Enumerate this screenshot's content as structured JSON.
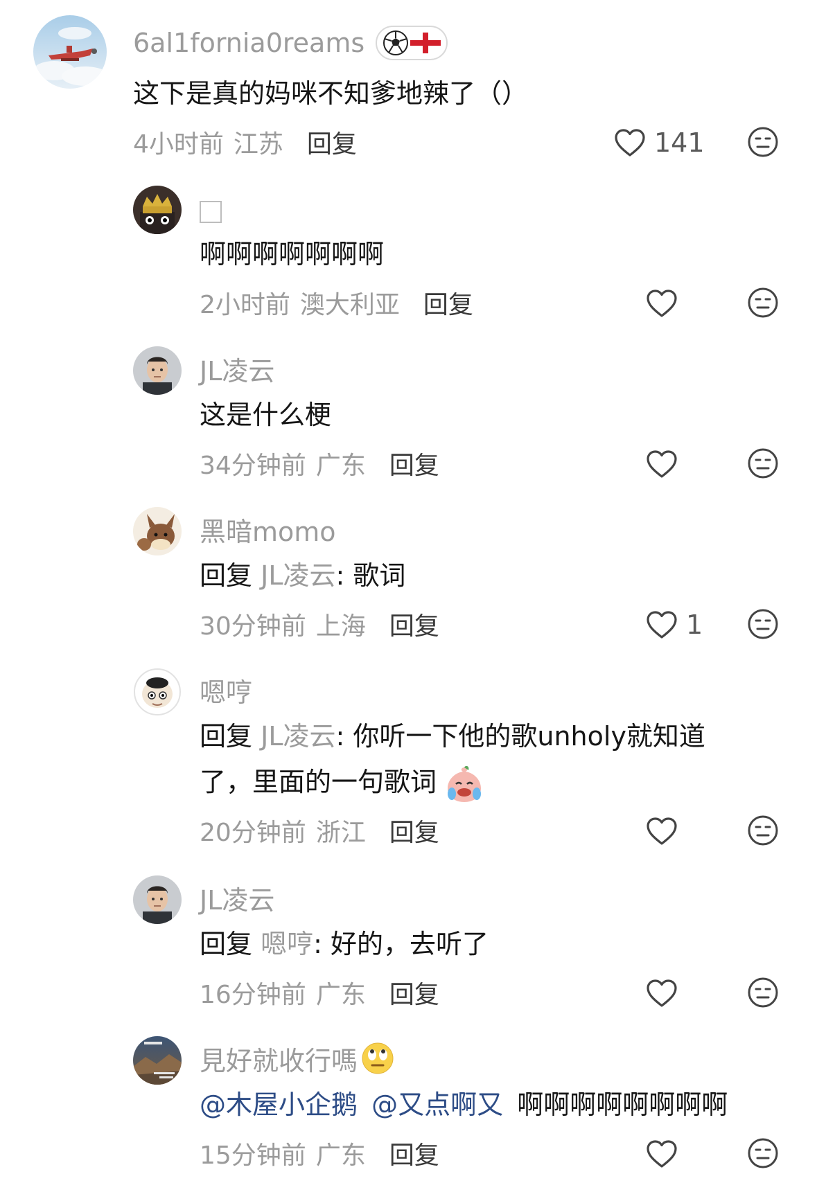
{
  "comments": [
    {
      "username": "6al1fornia0reams",
      "badges": [
        "soccer-ball",
        "england-flag"
      ],
      "text": "这下是真的妈咪不知爹地辣了（）",
      "time": "4小时前",
      "location": "江苏",
      "reply_label": "回复",
      "likes": "141"
    },
    {
      "username": "",
      "text": "啊啊啊啊啊啊啊",
      "time": "2小时前",
      "location": "澳大利亚",
      "reply_label": "回复",
      "likes": ""
    },
    {
      "username": "JL凌云",
      "text": "这是什么梗",
      "time": "34分钟前",
      "location": "广东",
      "reply_label": "回复",
      "likes": ""
    },
    {
      "username": "黑暗momo",
      "reply_prefix": "回复",
      "reply_target": "JL凌云",
      "text": ": 歌词",
      "time": "30分钟前",
      "location": "上海",
      "reply_label": "回复",
      "likes": "1"
    },
    {
      "username": "嗯哼",
      "reply_prefix": "回复",
      "reply_target": "JL凌云",
      "text": ": 你听一下他的歌unholy就知道",
      "text2": "了，里面的一句歌词",
      "time": "20分钟前",
      "location": "浙江",
      "reply_label": "回复",
      "likes": ""
    },
    {
      "username": "JL凌云",
      "reply_prefix": "回复",
      "reply_target": "嗯哼",
      "text": ": 好的，去听了",
      "time": "16分钟前",
      "location": "广东",
      "reply_label": "回复",
      "likes": ""
    },
    {
      "username": "見好就收行嗎",
      "mention1": "@木屋小企鹅",
      "mention2": "@又点啊又",
      "text": "啊啊啊啊啊啊啊啊",
      "time": "15分钟前",
      "location": "广东",
      "reply_label": "回复",
      "likes": ""
    }
  ],
  "colors": {
    "meta_gray": "#9b9b9b",
    "text": "#161616",
    "mention": "#2d4c86"
  }
}
